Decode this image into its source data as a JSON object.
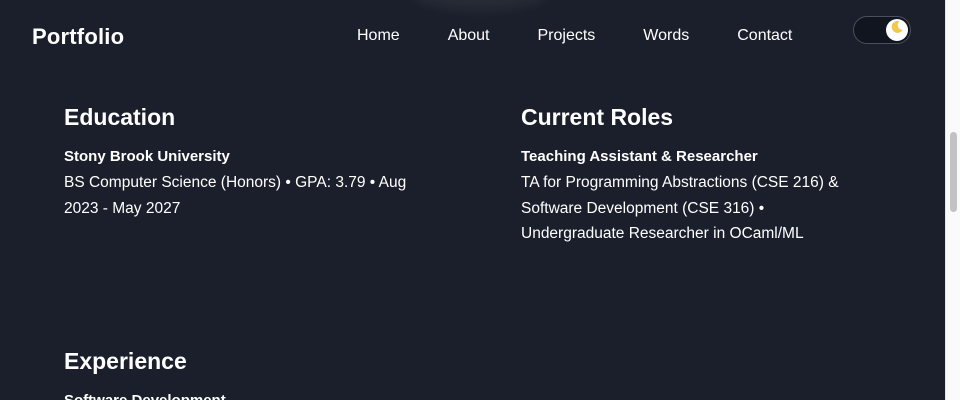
{
  "header": {
    "brand": "Portfolio",
    "nav": [
      {
        "label": "Home"
      },
      {
        "label": "About"
      },
      {
        "label": "Projects"
      },
      {
        "label": "Words"
      },
      {
        "label": "Contact"
      }
    ],
    "theme_toggle_icon": "moon-icon"
  },
  "education": {
    "heading": "Education",
    "school": "Stony Brook University",
    "line1": "BS Computer Science (Honors) • GPA: 3.79 • Aug",
    "line2": "2023 - May 2027"
  },
  "roles": {
    "heading": "Current Roles",
    "title": "Teaching Assistant & Researcher",
    "line1": "TA for Programming Abstractions (CSE 216) &",
    "line2": "Software Development (CSE 316) •",
    "line3": "Undergraduate Researcher in OCaml/ML"
  },
  "experience": {
    "heading": "Experience",
    "first_entry_title": "Software Development"
  },
  "colors": {
    "background": "#1b1f2b",
    "text": "#ffffff",
    "toggle_bg": "#111520",
    "moon": "#f2c94c"
  }
}
